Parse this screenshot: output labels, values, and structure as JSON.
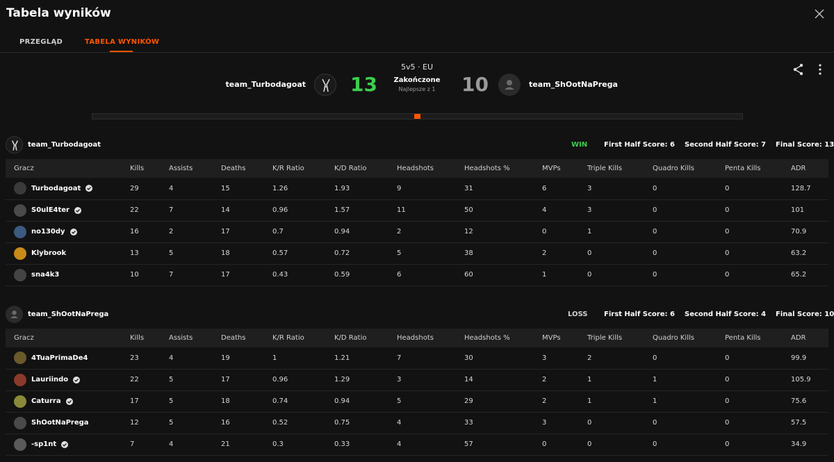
{
  "modal": {
    "title": "Tabela wyników"
  },
  "tabs": [
    {
      "label": "PRZEGLĄD",
      "active": false
    },
    {
      "label": "TABELA WYNIKÓW",
      "active": true
    }
  ],
  "match": {
    "mode": "5v5 · EU",
    "status": "Zakończone",
    "best_of": "Najlepsze z 1",
    "team1": {
      "name": "team_Turbodagoat",
      "score": "13"
    },
    "team2": {
      "name": "team_ShOotNaPrega",
      "score": "10"
    },
    "colors": {
      "win_score": "#3ccf4e",
      "loss_score": "#9a9a9a",
      "accent": "#ff5500"
    }
  },
  "columns": [
    "Gracz",
    "Kills",
    "Assists",
    "Deaths",
    "K/R Ratio",
    "K/D Ratio",
    "Headshots",
    "Headshots %",
    "MVPs",
    "Triple Kills",
    "Quadro Kills",
    "Penta Kills",
    "ADR"
  ],
  "teams": [
    {
      "name": "team_Turbodagoat",
      "result": "WIN",
      "first_half": "First Half Score: 6",
      "second_half": "Second Half Score: 7",
      "final": "Final Score: 13",
      "players": [
        {
          "name": "Turbodagoat",
          "verified": true,
          "stats": [
            "29",
            "4",
            "15",
            "1.26",
            "1.93",
            "9",
            "31",
            "6",
            "3",
            "0",
            "0",
            "128.7"
          ]
        },
        {
          "name": "S0ulE4ter",
          "verified": true,
          "stats": [
            "22",
            "7",
            "14",
            "0.96",
            "1.57",
            "11",
            "50",
            "4",
            "3",
            "0",
            "0",
            "101"
          ]
        },
        {
          "name": "no130dy",
          "verified": true,
          "stats": [
            "16",
            "2",
            "17",
            "0.7",
            "0.94",
            "2",
            "12",
            "0",
            "1",
            "0",
            "0",
            "70.9"
          ]
        },
        {
          "name": "Klybrook",
          "verified": false,
          "stats": [
            "13",
            "5",
            "18",
            "0.57",
            "0.72",
            "5",
            "38",
            "2",
            "0",
            "0",
            "0",
            "63.2"
          ]
        },
        {
          "name": "sna4k3",
          "verified": false,
          "stats": [
            "10",
            "7",
            "17",
            "0.43",
            "0.59",
            "6",
            "60",
            "1",
            "0",
            "0",
            "0",
            "65.2"
          ]
        }
      ]
    },
    {
      "name": "team_ShOotNaPrega",
      "result": "LOSS",
      "first_half": "First Half Score: 6",
      "second_half": "Second Half Score: 4",
      "final": "Final Score: 10",
      "players": [
        {
          "name": "4TuaPrimaDe4",
          "verified": false,
          "stats": [
            "23",
            "4",
            "19",
            "1",
            "1.21",
            "7",
            "30",
            "3",
            "2",
            "0",
            "0",
            "99.9"
          ]
        },
        {
          "name": "Lauriindo",
          "verified": true,
          "stats": [
            "22",
            "5",
            "17",
            "0.96",
            "1.29",
            "3",
            "14",
            "2",
            "1",
            "1",
            "0",
            "105.9"
          ]
        },
        {
          "name": "Caturra",
          "verified": true,
          "stats": [
            "17",
            "5",
            "18",
            "0.74",
            "0.94",
            "5",
            "29",
            "2",
            "1",
            "1",
            "0",
            "75.6"
          ]
        },
        {
          "name": "ShOotNaPrega",
          "verified": false,
          "stats": [
            "12",
            "5",
            "16",
            "0.52",
            "0.75",
            "4",
            "33",
            "3",
            "0",
            "0",
            "0",
            "57.5"
          ]
        },
        {
          "name": "-sp1nt",
          "verified": true,
          "stats": [
            "7",
            "4",
            "21",
            "0.3",
            "0.33",
            "4",
            "57",
            "0",
            "0",
            "0",
            "0",
            "34.9"
          ]
        }
      ]
    }
  ]
}
